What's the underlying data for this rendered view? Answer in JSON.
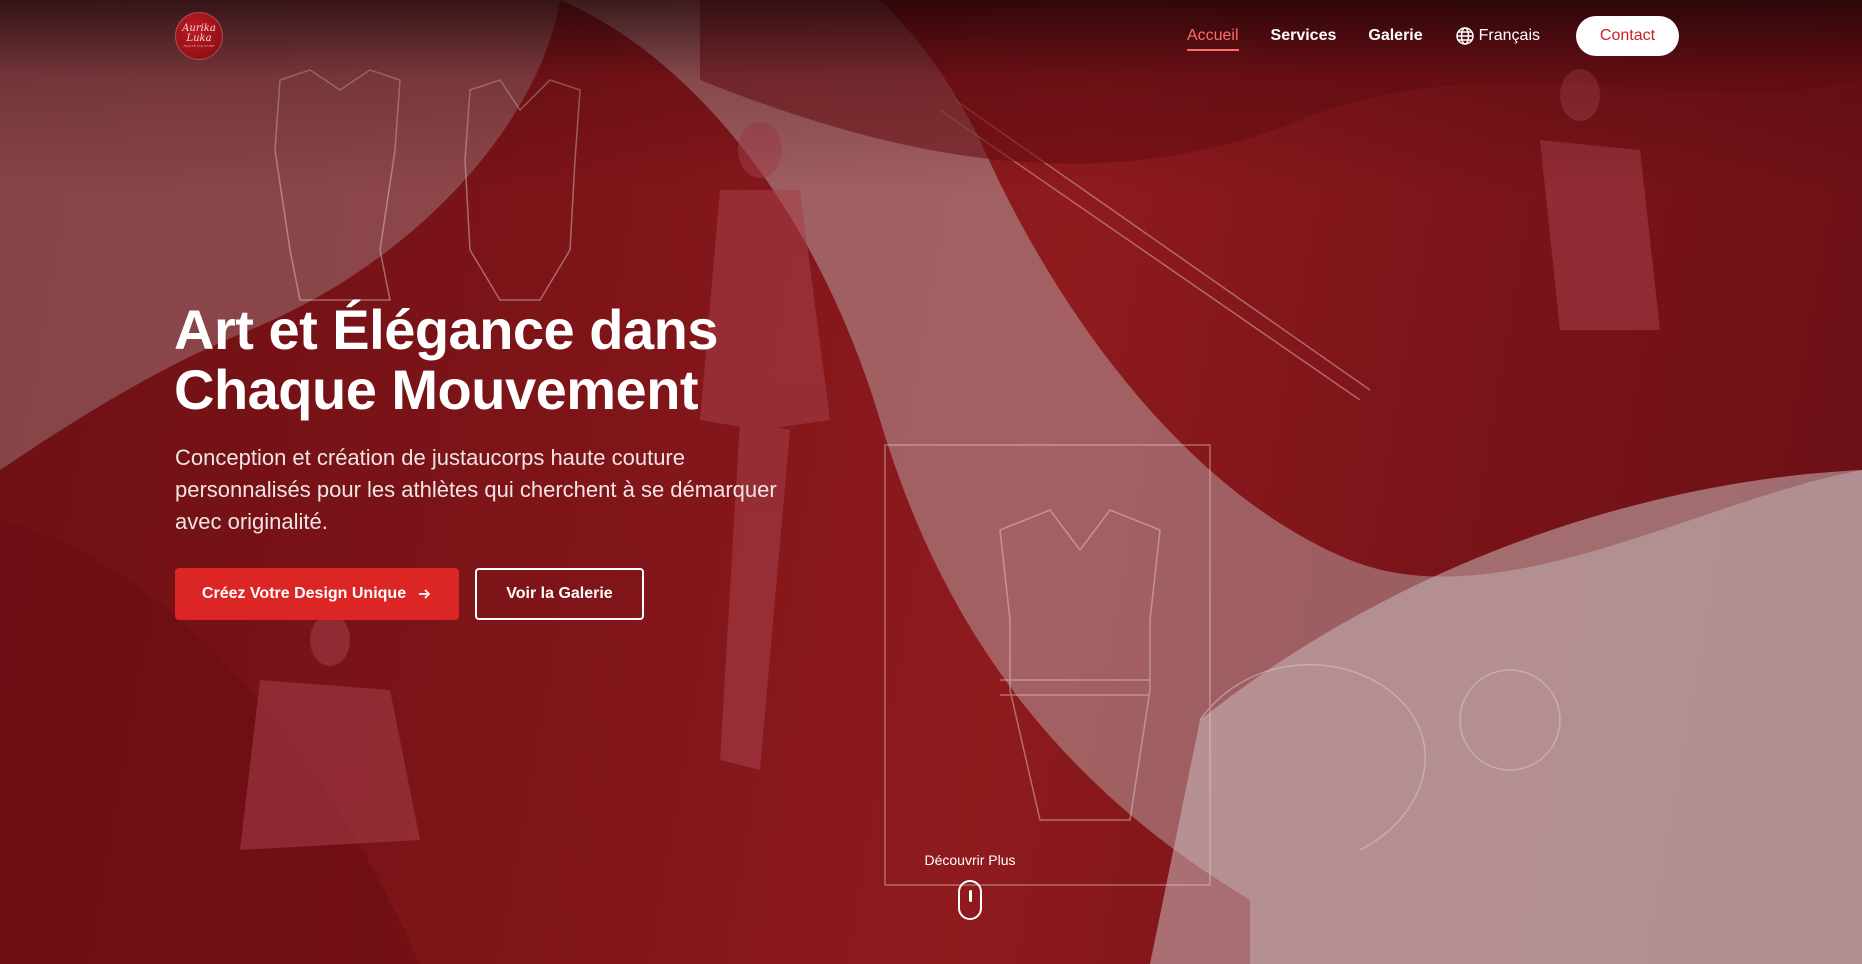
{
  "brand": {
    "logo_line1": "Aurika",
    "logo_line2": "Luka",
    "logo_line3": "HAUTE COUTURE"
  },
  "nav": {
    "items": [
      {
        "label": "Accueil",
        "active": true
      },
      {
        "label": "Services",
        "active": false
      },
      {
        "label": "Galerie",
        "active": false
      }
    ],
    "language": "Français",
    "contact": "Contact"
  },
  "hero": {
    "headline_line1": "Art et Élégance dans",
    "headline_line2": "Chaque Mouvement",
    "subtitle_line1": "Conception et création de justaucorps haute couture",
    "subtitle_line2": "personnalisés pour les athlètes qui cherchent à se démarquer",
    "subtitle_line3": "avec originalité.",
    "primary_cta": "Créez Votre Design Unique",
    "secondary_cta": "Voir la Galerie",
    "scroll_label": "Découvrir Plus"
  },
  "colors": {
    "accent": "#dc2626",
    "active_nav": "#ff6b6b",
    "background": "#7d1418"
  },
  "icons": {
    "language": "globe-icon",
    "cta_arrow": "arrow-right-icon",
    "scroll": "mouse-icon"
  }
}
